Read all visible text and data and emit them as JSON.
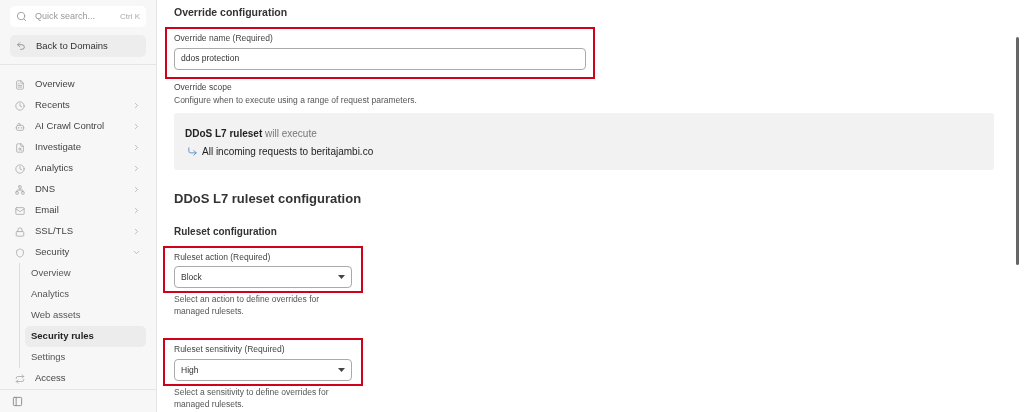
{
  "sidebar": {
    "search": {
      "placeholder": "Quick search...",
      "shortcut": "Ctrl K"
    },
    "back_button": "Back to Domains",
    "items": [
      {
        "label": "Overview"
      },
      {
        "label": "Recents",
        "expanded": false
      },
      {
        "label": "AI Crawl Control",
        "expanded": false
      },
      {
        "label": "Investigate",
        "expanded": false
      },
      {
        "label": "Analytics",
        "expanded": false
      },
      {
        "label": "DNS",
        "expanded": false
      },
      {
        "label": "Email",
        "expanded": false
      },
      {
        "label": "SSL/TLS",
        "expanded": false
      },
      {
        "label": "Security",
        "expanded": true,
        "children": [
          {
            "label": "Overview",
            "selected": false
          },
          {
            "label": "Analytics",
            "selected": false
          },
          {
            "label": "Web assets",
            "selected": false
          },
          {
            "label": "Security rules",
            "selected": true
          },
          {
            "label": "Settings",
            "selected": false
          }
        ]
      },
      {
        "label": "Access"
      }
    ]
  },
  "main": {
    "section_title": "Override configuration",
    "override_name": {
      "label": "Override name (Required)",
      "value": "ddos protection",
      "highlighted": true
    },
    "scope": {
      "title": "Override scope",
      "description": "Configure when to execute using a range of request parameters.",
      "ruleset": "DDoS L7 ruleset",
      "executes": "will execute",
      "target": "All incoming requests to beritajambi.co"
    },
    "heading": "DDoS L7 ruleset configuration",
    "subheading": "Ruleset configuration",
    "selects": [
      {
        "label": "Ruleset action (Required)",
        "value": "Block",
        "help": "Select an action to define overrides for managed rulesets.",
        "highlighted": true
      },
      {
        "label": "Ruleset sensitivity (Required)",
        "value": "High",
        "help": "Select a sensitivity to define overrides for managed rulesets.",
        "highlighted": true
      }
    ]
  }
}
